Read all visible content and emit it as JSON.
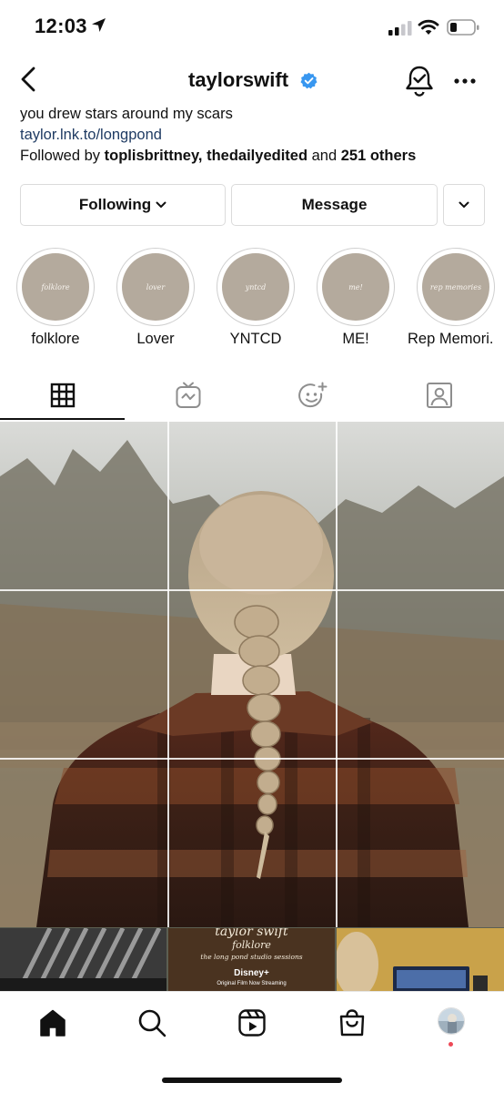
{
  "status_bar": {
    "time": "12:03",
    "icons": [
      "location-arrow-icon",
      "cellular-signal-icon",
      "wifi-icon",
      "battery-icon"
    ]
  },
  "header": {
    "username": "taylorswift",
    "verified": true,
    "icons": [
      "back-icon",
      "verified-icon",
      "notification-bell-icon",
      "more-icon"
    ]
  },
  "bio": {
    "text": "you drew stars around my scars",
    "link": "taylor.lnk.to/longpond",
    "followed_by_prefix": "Followed by ",
    "followed_by_users": "toplisbrittney, thedailyedited",
    "followed_by_and": " and ",
    "followed_by_others": "251 others"
  },
  "actions": {
    "following_label": "Following",
    "message_label": "Message"
  },
  "highlights": [
    {
      "label": "folklore",
      "cover_text": "folklore"
    },
    {
      "label": "Lover",
      "cover_text": "lover"
    },
    {
      "label": "YNTCD",
      "cover_text": "yntcd"
    },
    {
      "label": "ME!",
      "cover_text": "me!"
    },
    {
      "label": "Rep Memori...",
      "cover_text": "rep memories"
    }
  ],
  "tabs": [
    {
      "name": "grid",
      "icon": "grid-icon",
      "active": true
    },
    {
      "name": "igtv",
      "icon": "igtv-icon",
      "active": false
    },
    {
      "name": "effects",
      "icon": "effects-icon",
      "active": false
    },
    {
      "name": "tagged",
      "icon": "tagged-icon",
      "active": false
    }
  ],
  "posts": {
    "folklore_post": {
      "line1": "taylor swift",
      "line2": "folklore",
      "line3": "the long pond studio sessions",
      "logo": "Disney+",
      "caption": "Original Film Now Streaming"
    }
  },
  "bottom_nav": {
    "items": [
      "home-icon",
      "search-icon",
      "reels-icon",
      "shop-icon",
      "profile-avatar"
    ]
  },
  "colors": {
    "accent_blue": "#3897f0",
    "link": "#1f3b63",
    "highlight_cover": "#b4aa9d",
    "notification": "#ed4956"
  }
}
